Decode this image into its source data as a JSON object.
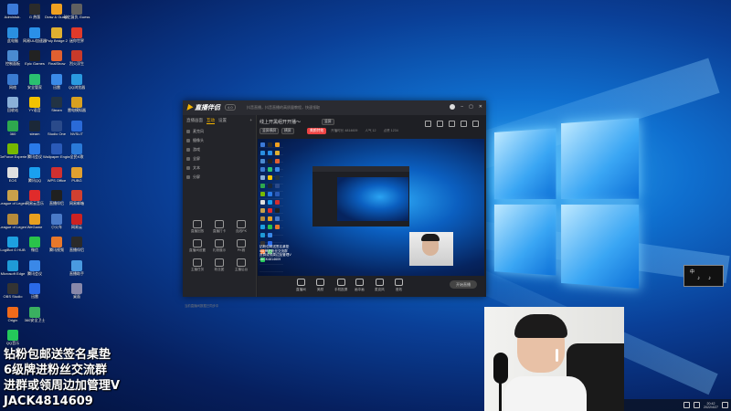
{
  "desktop": {
    "icons_col1": [
      {
        "label": "Administr..",
        "color": "#3c7ad8"
      },
      {
        "label": "此电脑",
        "color": "#2a8fe0"
      },
      {
        "label": "控制面板",
        "color": "#4a8ad0"
      },
      {
        "label": "网络",
        "color": "#3a7bd0"
      },
      {
        "label": "回收站",
        "color": "#8ab0d8"
      },
      {
        "label": "360",
        "color": "#2ea84e"
      },
      {
        "label": "GeForce Experience",
        "color": "#76b900"
      },
      {
        "label": "EOS",
        "color": "#e0e0e0"
      },
      {
        "label": "League of Legends",
        "color": "#c8a04a"
      },
      {
        "label": "League of Legends",
        "color": "#b58a3a"
      },
      {
        "label": "LogiBot G HUB",
        "color": "#1da0e0"
      },
      {
        "label": "Microsoft Edge",
        "color": "#1f9ad6"
      },
      {
        "label": "OBS Studio",
        "color": "#333333"
      },
      {
        "label": "Origin",
        "color": "#f06a1a"
      },
      {
        "label": "QQ音乐",
        "color": "#24c85a"
      }
    ],
    "icons_col2": [
      {
        "label": "G 热版",
        "color": "#2b2b2b"
      },
      {
        "label": "网易UU加速器",
        "color": "#2a90e8"
      },
      {
        "label": "Epic Games",
        "color": "#222222"
      },
      {
        "label": "安全管家",
        "color": "#2ac070"
      },
      {
        "label": "YY语音",
        "color": "#f2c200"
      },
      {
        "label": "steam",
        "color": "#1b2838"
      },
      {
        "label": "腾讯会议",
        "color": "#2a7ae8"
      },
      {
        "label": "腾讯QQ",
        "color": "#1aa0f0"
      },
      {
        "label": "网易云音乐",
        "color": "#e02b2b"
      },
      {
        "label": "WeGame",
        "color": "#e8a020"
      },
      {
        "label": "微信",
        "color": "#2ac34a"
      },
      {
        "label": "腾讯会议",
        "color": "#3a88e8"
      },
      {
        "label": "迅雷",
        "color": "#2a6ae8"
      },
      {
        "label": "360安全卫士",
        "color": "#3ab060"
      }
    ],
    "icons_col3": [
      {
        "label": "Draw & Guess",
        "color": "#f0a020"
      },
      {
        "label": "Poly Bridge 2",
        "color": "#e0b030"
      },
      {
        "label": "FinalShow",
        "color": "#e06030"
      },
      {
        "label": "迅雷",
        "color": "#3a8ae8"
      },
      {
        "label": "Steam",
        "color": "#223344"
      },
      {
        "label": "Studio One",
        "color": "#2a4a8a"
      },
      {
        "label": "Wallpaper Engine",
        "color": "#2a5ab8"
      },
      {
        "label": "WPS Office",
        "color": "#d03030"
      },
      {
        "label": "直播伴侣",
        "color": "#202020"
      },
      {
        "label": "小火车",
        "color": "#4a7ac8"
      },
      {
        "label": "腾讯视频",
        "color": "#e8782a"
      }
    ],
    "icons_col4": [
      {
        "label": "破忆复仇 Guess",
        "color": "#606060"
      },
      {
        "label": "迷你世界",
        "color": "#e03a2a"
      },
      {
        "label": "烈火浮生",
        "color": "#c83a2a"
      },
      {
        "label": "QQ浏览器",
        "color": "#2a9ae0"
      },
      {
        "label": "雷电模拟器",
        "color": "#d8a020"
      },
      {
        "label": "NVSLIT",
        "color": "#2a6ad8"
      },
      {
        "label": "全民K歌",
        "color": "#2a7ad8"
      },
      {
        "label": "PUBG",
        "color": "#e0a030"
      },
      {
        "label": "网易邮箱",
        "color": "#d04030"
      },
      {
        "label": "网易云",
        "color": "#cc2222"
      },
      {
        "label": "直播伴侣",
        "color": "#2a2a2a"
      },
      {
        "label": "直播助手",
        "color": "#4a9ae0"
      },
      {
        "label": "桌面",
        "color": "#8888aa"
      }
    ]
  },
  "app": {
    "logo_main": "直播伴侣",
    "version": "4.0",
    "notice": "抖音直播，抖音直播的高质量教程，快速领取",
    "tabs": [
      "直播画面",
      "互动",
      "设置"
    ],
    "sources": [
      "麦克风",
      "摄像头",
      "游戏",
      "全屏",
      "文本",
      "分屏"
    ],
    "tools": [
      {
        "label": "直播回放"
      },
      {
        "label": "直播打卡"
      },
      {
        "label": "连线PK"
      },
      {
        "label": "直播间设置"
      },
      {
        "label": "礼物展示"
      },
      {
        "label": "PK赛"
      },
      {
        "label": "主播任务"
      },
      {
        "label": "粉丝团"
      },
      {
        "label": "主播后台"
      }
    ],
    "footer": "当前直播间数据已同步中",
    "stage_title": "线上开黑组开开播～",
    "stage_tag": "竖屏",
    "stage_buttons": [
      "竖屏横屏",
      "横屏",
      "美颜特效"
    ],
    "stage_meta": [
      "开播时长 4814609",
      "人气 12",
      "点赞 1234"
    ],
    "preview_text": [
      "钻粉包邮送签名桌垫",
      "6级牌进粉丝交流群",
      "进群或领周边加管理V",
      "JACK4814609"
    ],
    "bottom_tools": [
      "直播间",
      "美颜",
      "手机投屏",
      "画中画",
      "麦克风",
      "音效"
    ],
    "start_live": "开始直播"
  },
  "overlay_text": {
    "line1": "钻粉包邮送签名桌垫",
    "line2": "6级牌进粉丝交流群",
    "line3": "进群或领周边加管理V",
    "line4": "JACK4814609"
  },
  "taskbar": {
    "time": "20:42",
    "date": "2022/4/27"
  },
  "mini_widget": {
    "l1": "中",
    "l2": "♪",
    "l3": "♪"
  }
}
